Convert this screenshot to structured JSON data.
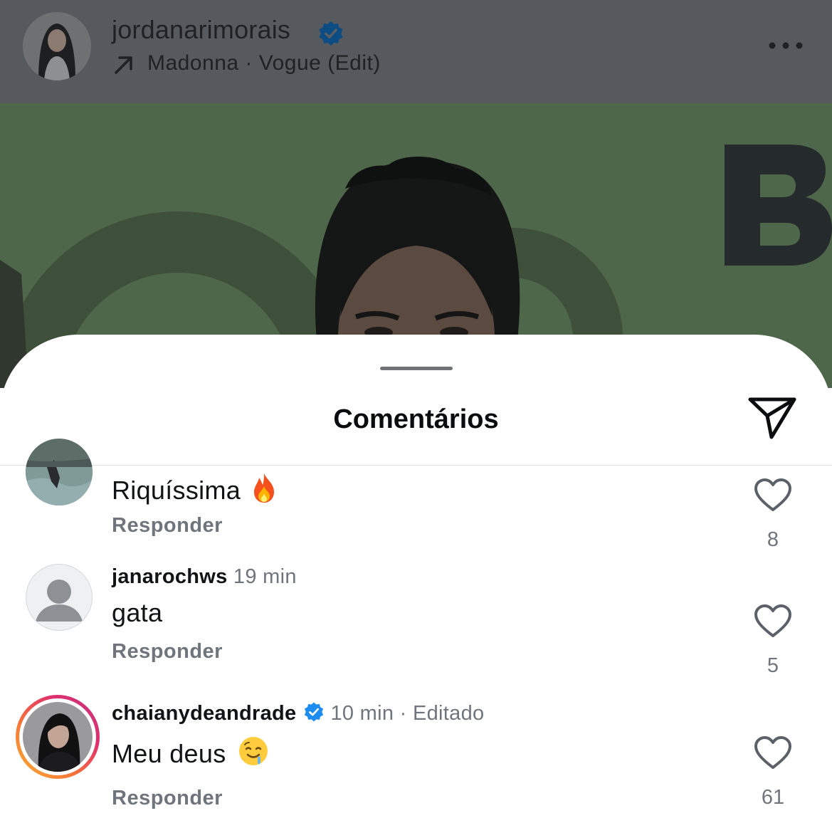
{
  "post": {
    "username": "jordanarimorais",
    "audio": "Madonna · Vogue (Edit)",
    "icons": {
      "verified": "verified-badge-icon",
      "audio": "arrow-up-right-icon",
      "more": "more-horizontal-icon"
    }
  },
  "sheet": {
    "title": "Comentários",
    "share_icon": "paper-plane-icon"
  },
  "comments": [
    {
      "username": "",
      "time": "",
      "edited": "",
      "text": "Riquíssima",
      "emoji": "fire",
      "reply": "Responder",
      "likes": "8"
    },
    {
      "username": "janarochws",
      "time": "19 min",
      "edited": "",
      "text": "gata",
      "reply": "Responder",
      "likes": "5"
    },
    {
      "username": "chaianydeandrade",
      "time": "10 min",
      "edited": "· Editado",
      "text": "Meu deus",
      "emoji": "drooling-face",
      "reply": "Responder",
      "likes": "61"
    }
  ],
  "colors": {
    "verified": "#1d8cf0",
    "story_ring_start": "#f9b233",
    "story_ring_end": "#e1306c",
    "meta_text": "#6f757d"
  }
}
